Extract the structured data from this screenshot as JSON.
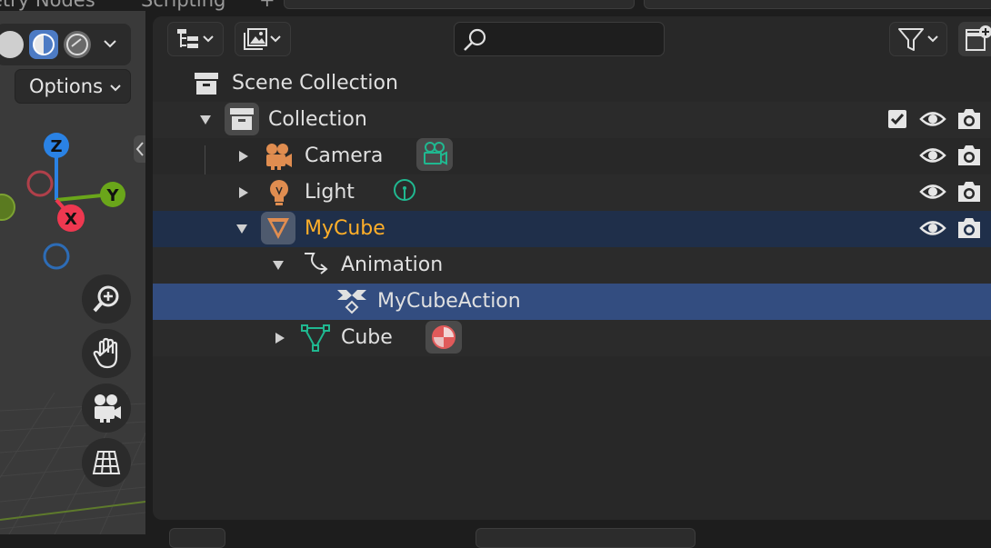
{
  "topbar": {
    "tab_geometry_nodes": "etry Nodes",
    "tab_scripting": "Scripting",
    "tab_plus": "+"
  },
  "viewport": {
    "options_label": "Options",
    "gizmo": {
      "x_label": "X",
      "y_label": "Y",
      "z_label": "Z",
      "x_color": "#ee3850",
      "y_color": "#6aa61a",
      "z_color": "#2a82e4"
    },
    "nav_buttons": [
      "zoom-icon",
      "hand-pan-icon",
      "camera-view-icon",
      "ortho-grid-icon"
    ]
  },
  "outliner": {
    "header": {
      "display_mode_icon": "outliner-tree-icon",
      "filter_icon": "filter-funnel-icon",
      "new_collection_icon": "new-collection-icon",
      "search_placeholder": ""
    },
    "rows": [
      {
        "id": "scene-collection",
        "label": "Scene Collection",
        "icon": "scene-collection-icon"
      },
      {
        "id": "collection",
        "label": "Collection",
        "icon": "collection-box-icon",
        "expanded": true,
        "checked": true
      },
      {
        "id": "camera",
        "label": "Camera",
        "icon": "camera-object-icon",
        "data_icon": "camera-data-icon",
        "expanded": false
      },
      {
        "id": "light",
        "label": "Light",
        "icon": "light-bulb-icon",
        "data_icon": "light-data-icon",
        "expanded": false
      },
      {
        "id": "mycube",
        "label": "MyCube",
        "icon": "mesh-object-icon",
        "expanded": true,
        "active": true
      },
      {
        "id": "animation",
        "label": "Animation",
        "icon": "animation-curve-icon",
        "expanded": true
      },
      {
        "id": "mycubeaction",
        "label": "MyCubeAction",
        "icon": "action-keyframe-icon",
        "selected": true
      },
      {
        "id": "cube",
        "label": "Cube",
        "icon": "mesh-data-icon",
        "material_icon": "material-sphere-icon",
        "expanded": false
      }
    ],
    "colors": {
      "active_row": "#1f2f4a",
      "selected_row": "#334d80",
      "active_label": "#ffaf29",
      "object_icon": "#e08d50",
      "data_icon": "#20b890"
    }
  }
}
